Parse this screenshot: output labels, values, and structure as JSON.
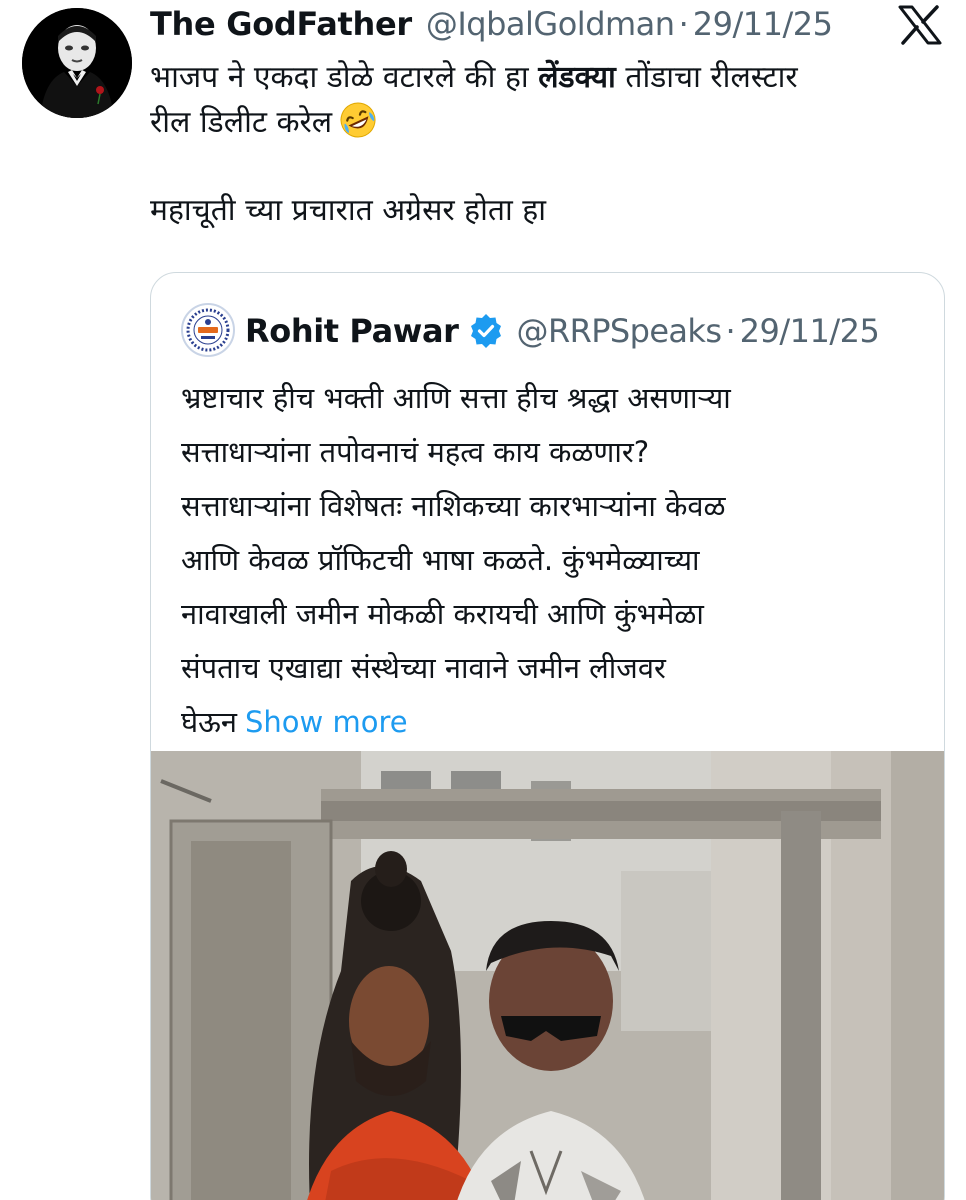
{
  "tweet": {
    "display_name": "The GodFather",
    "handle": "@IqbalGoldman",
    "separator": "·",
    "date": "29/11/25",
    "text_lines": [
      {
        "before": "भाजप ने एकदा डोळे वटारले की हा ",
        "bold": "लेंडक्या",
        "after": " तोंडाचा रीलस्टार"
      },
      {
        "before": "रील डिलीट करेल",
        "bold": "",
        "after": ""
      }
    ],
    "text_line3": "महाचूती च्या प्रचारात अग्रेसर होता हा",
    "emoji": "rolling-on-floor-laughing"
  },
  "quote": {
    "display_name": "Rohit Pawar",
    "handle": "@RRPSpeaks",
    "separator": "·",
    "date": "29/11/25",
    "verified": true,
    "text_lines": [
      "भ्रष्टाचार हीच भक्ती आणि सत्ता  हीच श्रद्धा असणाऱ्या",
      "सत्ताधाऱ्यांना तपोवनाचं महत्व काय कळणार?",
      "सत्ताधाऱ्यांना विशेषतः नाशिकच्या कारभाऱ्यांना केवळ",
      "आणि केवळ प्रॉफिटची भाषा कळते. कुंभमेळ्याच्या",
      "नावाखाली जमीन मोकळी करायची आणि कुंभमेळा",
      "संपताच एखाद्या संस्थेच्या नावाने जमीन लीजवर",
      "घेऊन"
    ],
    "show_more": "Show more"
  },
  "colors": {
    "text": "#0f1419",
    "secondary": "#536471",
    "link": "#1d9bf0",
    "border": "#cfd9de",
    "verified": "#1d9bf0"
  },
  "icons": {
    "close": "x-logo-icon",
    "verified": "verified-badge-icon"
  }
}
